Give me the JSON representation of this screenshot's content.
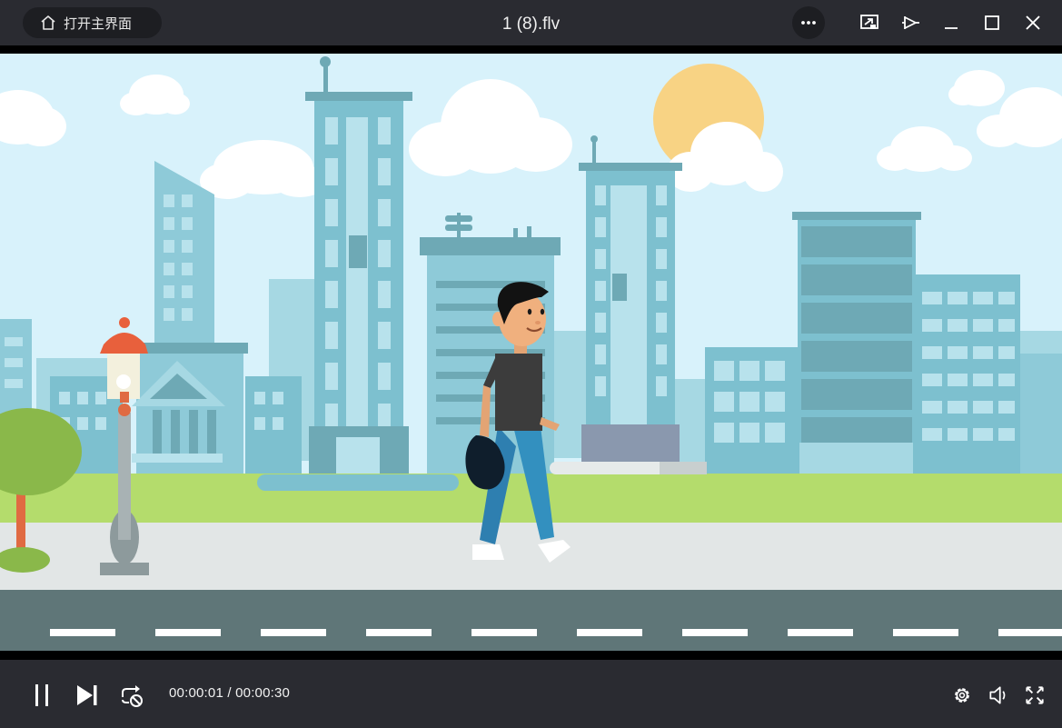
{
  "titlebar": {
    "home_button_label": "打开主界面",
    "file_title": "1 (8).flv"
  },
  "icons": {
    "home": "home-icon",
    "more": "more-dots-icon",
    "screen_cast": "screen-cast-icon",
    "pin_on_top": "pin-icon",
    "minimize": "minimize-icon",
    "maximize": "maximize-icon",
    "close": "close-icon",
    "pause": "pause-icon",
    "next": "next-track-icon",
    "loop": "loop-off-icon",
    "settings": "gear-icon",
    "volume": "volume-icon",
    "fullscreen": "fullscreen-icon"
  },
  "playback": {
    "current_time": "00:00:01",
    "separator": " / ",
    "total_time": "00:00:30"
  },
  "colors": {
    "chrome": "#2a2b31",
    "sky": "#d8f2fb",
    "building": "#7dc0cf",
    "grass": "#b4dc6c",
    "road": "#5f7678"
  }
}
